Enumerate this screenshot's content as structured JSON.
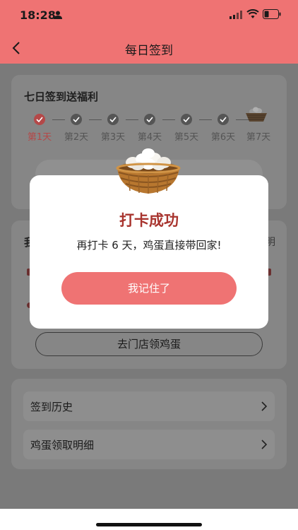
{
  "status_bar": {
    "time": "18:28"
  },
  "nav": {
    "title": "每日签到"
  },
  "checkin_card": {
    "title": "七日签到送福利",
    "days": [
      "第1天",
      "第2天",
      "第3天",
      "第4天",
      "第5天",
      "第6天",
      "第7天"
    ],
    "current_day_index": 0
  },
  "eggs_card": {
    "title_fragment": "我",
    "right_fragment": "明",
    "store_button": "去门店领鸡蛋"
  },
  "menu": {
    "items": [
      "签到历史",
      "鸡蛋领取明细"
    ]
  },
  "modal": {
    "title": "打卡成功",
    "message": "再打卡 6 天，鸡蛋直接带回家!",
    "confirm_button": "我记住了"
  },
  "colors": {
    "brand": "#ef7373",
    "title_red": "#a8342e"
  }
}
